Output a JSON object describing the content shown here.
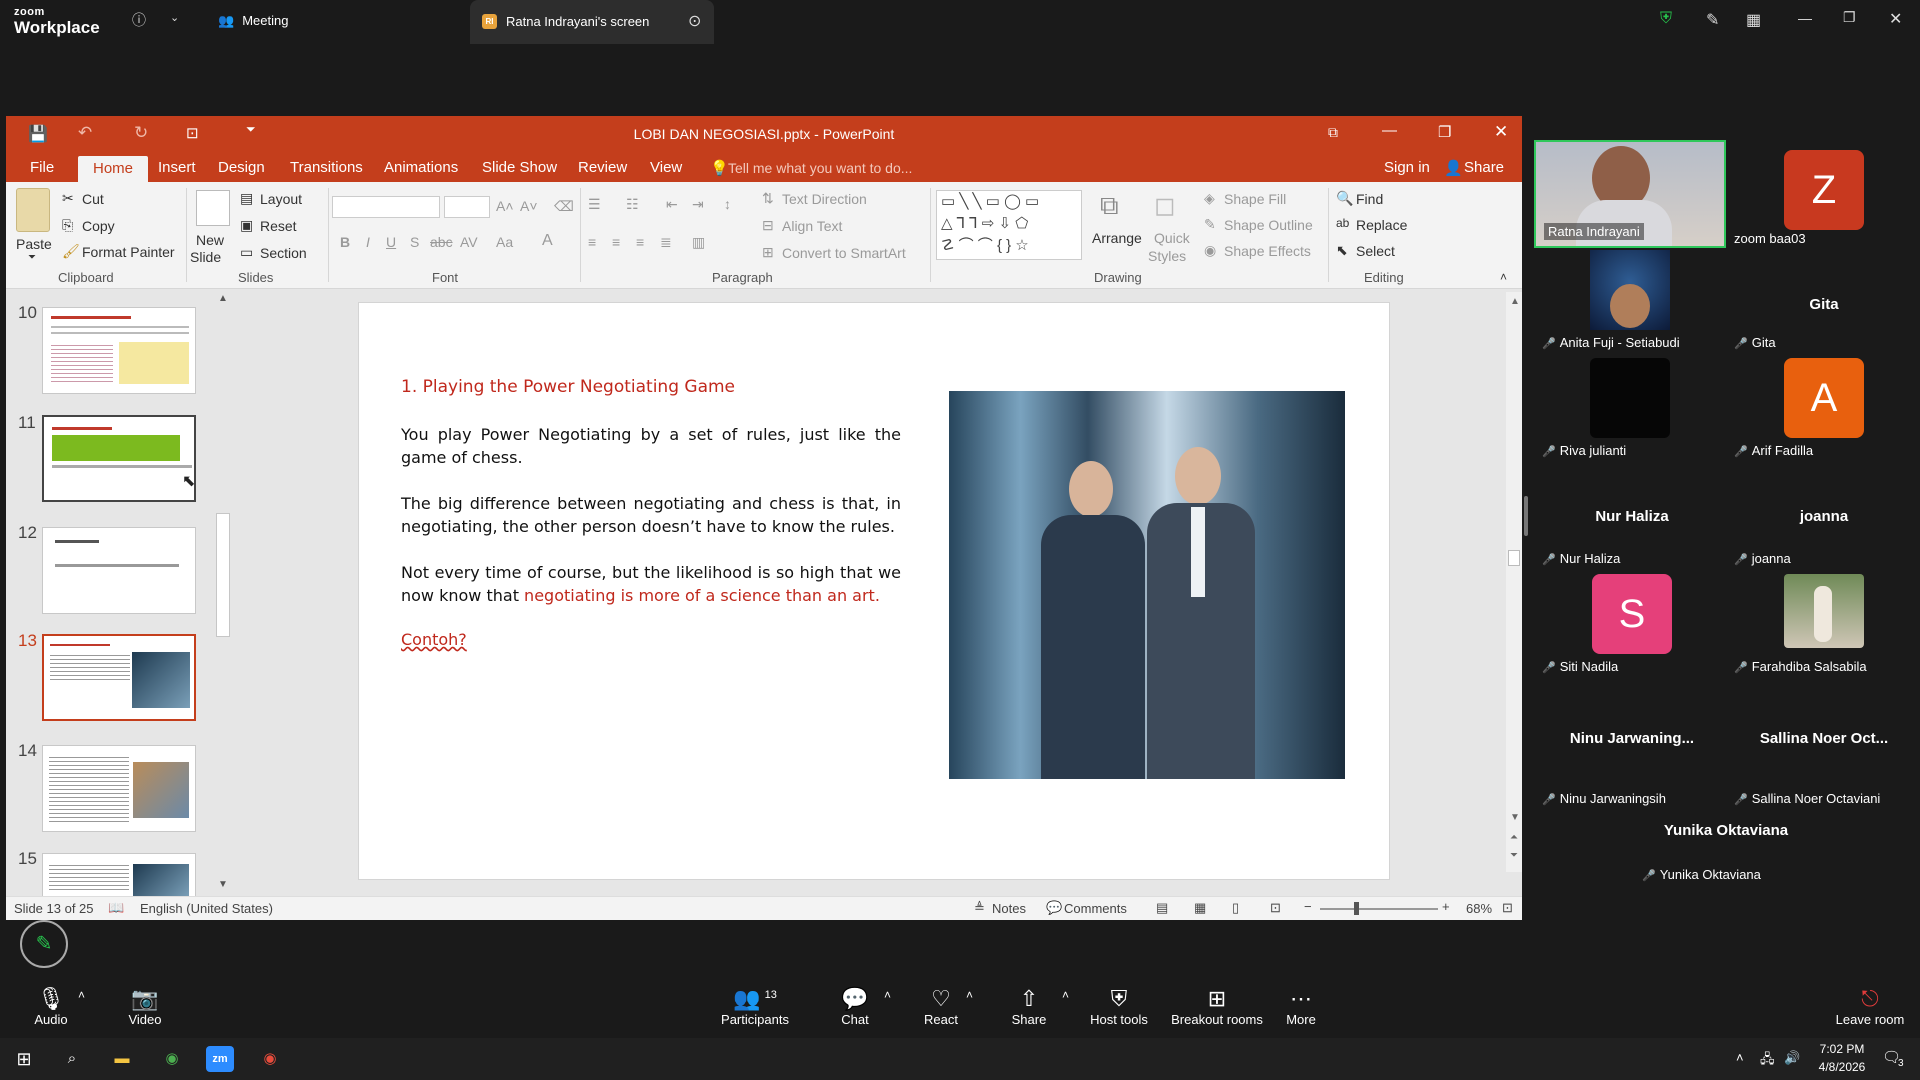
{
  "zoom": {
    "brand_small": "zoom",
    "brand_big": "Workplace",
    "meeting_label": "Meeting",
    "share_tab_label": "Ratna Indrayani's screen",
    "share_tab_badge": "RI"
  },
  "ppt": {
    "window_title": "LOBI DAN NEGOSIASI.pptx - PowerPoint",
    "tabs": [
      "File",
      "Home",
      "Insert",
      "Design",
      "Transitions",
      "Animations",
      "Slide Show",
      "Review",
      "View"
    ],
    "tell_me": "Tell me what you want to do...",
    "sign_in": "Sign in",
    "share": "Share",
    "ribbon": {
      "paste": "Paste",
      "cut": "Cut",
      "copy": "Copy",
      "format_painter": "Format Painter",
      "clipboard": "Clipboard",
      "new_slide_1": "New",
      "new_slide_2": "Slide",
      "layout": "Layout",
      "reset": "Reset",
      "section": "Section",
      "slides": "Slides",
      "font": "Font",
      "paragraph": "Paragraph",
      "text_direction": "Text Direction",
      "align_text": "Align Text",
      "convert_smartart": "Convert to SmartArt",
      "arrange": "Arrange",
      "quick_styles_1": "Quick",
      "quick_styles_2": "Styles",
      "shape_fill": "Shape Fill",
      "shape_outline": "Shape Outline",
      "shape_effects": "Shape Effects",
      "drawing": "Drawing",
      "find": "Find",
      "replace": "Replace",
      "select": "Select",
      "editing": "Editing"
    },
    "thumbs": [
      {
        "num": "10"
      },
      {
        "num": "11"
      },
      {
        "num": "12"
      },
      {
        "num": "13"
      },
      {
        "num": "14"
      },
      {
        "num": "15"
      }
    ],
    "slide": {
      "heading": "1. Playing the Power Negotiating Game",
      "p1": "You play Power Negotiating by a set of rules, just like the game of chess.",
      "p2": "The big difference between negotiating and chess is that, in negotiating, the other person doesn’t have to know the rules.",
      "p3_plain": "Not every time of course, but the likelihood is so high that we now know that ",
      "p3_red": "negotiating is more of a science than an art.",
      "contoh": "Contoh?"
    },
    "status": {
      "slide_of": "Slide 13 of 25",
      "language": "English (United States)",
      "notes": "Notes",
      "comments": "Comments",
      "zoom": "68%"
    }
  },
  "gallery": [
    {
      "name": "Ratna Indrayani"
    },
    {
      "name": "zoom baa03",
      "initial": "Z",
      "color": "#c8391f"
    },
    {
      "name": "Anita Fuji - Setiabudi"
    },
    {
      "name": "Gita",
      "big": "Gita"
    },
    {
      "name": "Riva julianti"
    },
    {
      "name": "Arif Fadilla",
      "initial": "A",
      "color": "#e8600e"
    },
    {
      "name": "Nur Haliza",
      "big": "Nur Haliza"
    },
    {
      "name": "joanna",
      "big": "joanna"
    },
    {
      "name": "Siti Nadila",
      "initial": "S",
      "color": "#e5407a"
    },
    {
      "name": "Farahdiba Salsabila"
    },
    {
      "name": "Ninu Jarwaningsih",
      "big": "Ninu Jarwaning..."
    },
    {
      "name": "Sallina Noer Octaviani",
      "big": "Sallina Noer Oct..."
    },
    {
      "name": "Yunika Oktaviana",
      "big": "Yunika Oktaviana"
    }
  ],
  "toolbar": {
    "audio": "Audio",
    "video": "Video",
    "participants": "Participants",
    "participants_count": "13",
    "chat": "Chat",
    "react": "React",
    "share": "Share",
    "host_tools": "Host tools",
    "breakout_rooms": "Breakout rooms",
    "more": "More",
    "leave_room": "Leave room"
  },
  "taskbar": {
    "time": "7:02 PM",
    "date": "4/8/2026",
    "notif_count": "3"
  }
}
